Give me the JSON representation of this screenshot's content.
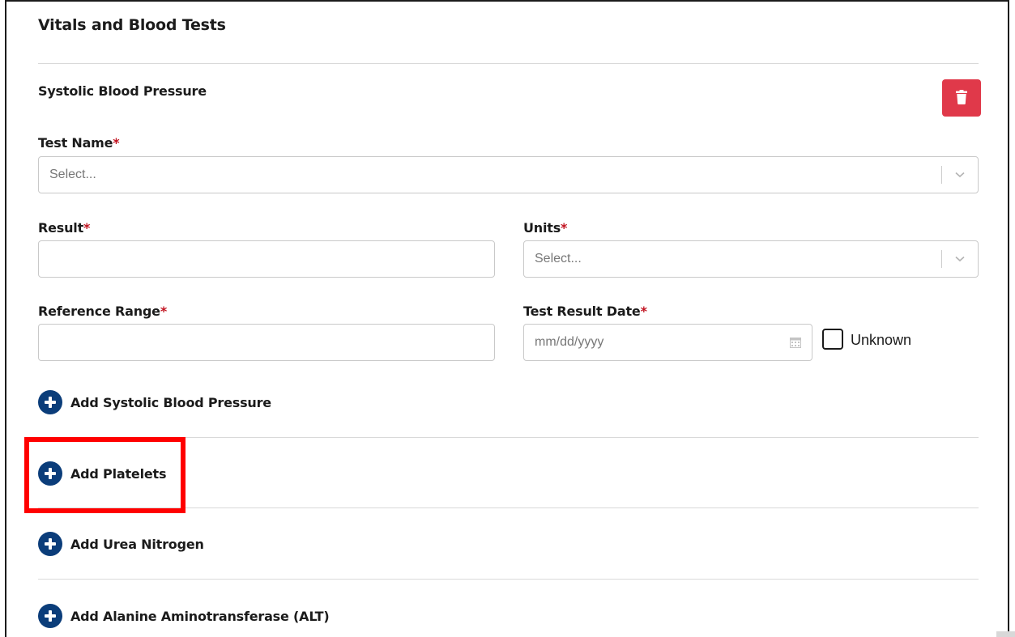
{
  "section": {
    "title": "Vitals and Blood Tests"
  },
  "test_block": {
    "title": "Systolic Blood Pressure",
    "delete_icon": "trash-icon",
    "fields": {
      "test_name": {
        "label": "Test Name",
        "required_mark": "*",
        "placeholder": "Select..."
      },
      "result": {
        "label": "Result",
        "required_mark": "*",
        "value": ""
      },
      "units": {
        "label": "Units",
        "required_mark": "*",
        "placeholder": "Select..."
      },
      "reference_range": {
        "label": "Reference Range",
        "required_mark": "*",
        "value": ""
      },
      "test_result_date": {
        "label": "Test Result Date",
        "required_mark": "*",
        "placeholder": "mm/dd/yyyy"
      }
    },
    "unknown_checkbox": {
      "label": "Unknown",
      "checked": false
    }
  },
  "add_actions": [
    {
      "label": "Add Systolic Blood Pressure",
      "icon": "plus-circle-icon"
    },
    {
      "label": "Add Platelets",
      "icon": "plus-circle-icon"
    },
    {
      "label": "Add Urea Nitrogen",
      "icon": "plus-circle-icon"
    },
    {
      "label": "Add Alanine Aminotransferase (ALT)",
      "icon": "plus-circle-icon"
    }
  ],
  "colors": {
    "delete": "#e0394a",
    "plus": "#0b3d7a",
    "required": "#c1121f",
    "highlight": "#ff0000"
  }
}
